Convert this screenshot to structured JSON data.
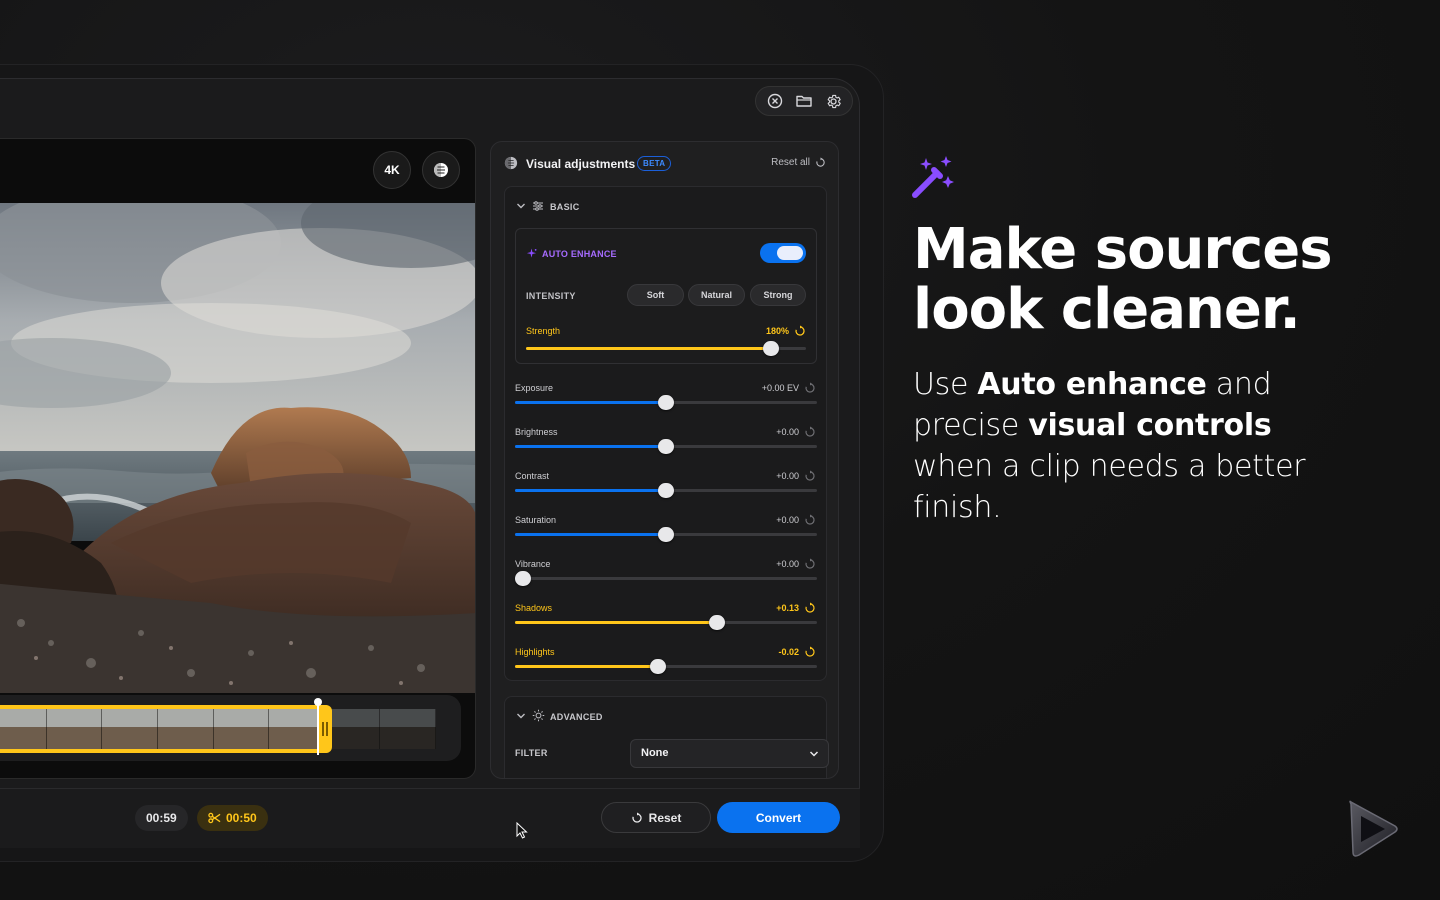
{
  "preview": {
    "badge_4k": "4K",
    "time_current": "00:59",
    "time_trim": "00:50"
  },
  "panel": {
    "title": "Visual adjustments",
    "beta": "BETA",
    "reset_all": "Reset all",
    "basic": {
      "label": "BASIC",
      "auto_enhance": {
        "label": "AUTO ENHANCE",
        "enabled": true,
        "intensity_label": "INTENSITY",
        "options": [
          "Soft",
          "Natural",
          "Strong"
        ],
        "strength_label": "Strength",
        "strength_value": "180%",
        "strength_level": 0.875
      },
      "sliders": [
        {
          "label": "Exposure",
          "value": "+0.00 EV",
          "level": 0.5,
          "color": "#0a72ef",
          "highlight": false
        },
        {
          "label": "Brightness",
          "value": "+0.00",
          "level": 0.5,
          "color": "#0a72ef",
          "highlight": false
        },
        {
          "label": "Contrast",
          "value": "+0.00",
          "level": 0.5,
          "color": "#0a72ef",
          "highlight": false
        },
        {
          "label": "Saturation",
          "value": "+0.00",
          "level": 0.5,
          "color": "#0a72ef",
          "highlight": false
        },
        {
          "label": "Vibrance",
          "value": "+0.00",
          "level": 0.027,
          "color": "#0a72ef",
          "highlight": false
        },
        {
          "label": "Shadows",
          "value": "+0.13",
          "level": 0.67,
          "color": "#ffc61a",
          "highlight": true
        },
        {
          "label": "Highlights",
          "value": "-0.02",
          "level": 0.475,
          "color": "#ffc61a",
          "highlight": true
        }
      ]
    },
    "advanced": {
      "label": "ADVANCED",
      "filter_label": "FILTER",
      "filter_value": "None"
    }
  },
  "actions": {
    "reset": "Reset",
    "convert": "Convert"
  },
  "marketing": {
    "headline_line1": "Make sources",
    "headline_line2": "look cleaner.",
    "sub_1": "Use ",
    "sub_2": "Auto enhance",
    "sub_3": " and precise ",
    "sub_4": "visual controls",
    "sub_5": " when a clip needs a better finish."
  },
  "colors": {
    "accent_blue": "#0a72ef",
    "accent_yellow": "#ffc61a",
    "accent_purple": "#8a4dff"
  }
}
